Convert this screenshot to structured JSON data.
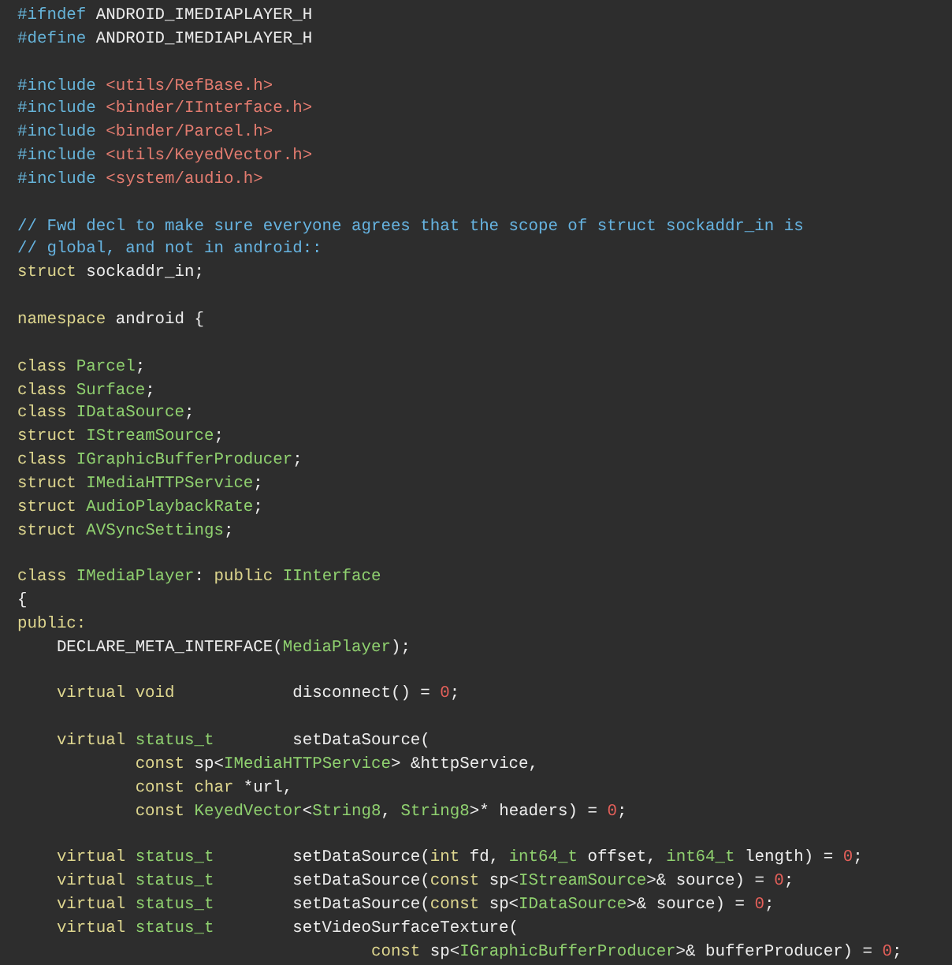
{
  "editor": {
    "lines": [
      {
        "kind": "code",
        "tokens": [
          {
            "kind": "directive",
            "text": "#ifndef"
          },
          {
            "kind": "plain",
            "text": " ANDROID_IMEDIAPLAYER_H"
          }
        ]
      },
      {
        "kind": "code",
        "tokens": [
          {
            "kind": "directive",
            "text": "#define"
          },
          {
            "kind": "plain",
            "text": " ANDROID_IMEDIAPLAYER_H"
          }
        ]
      },
      {
        "kind": "blank"
      },
      {
        "kind": "code",
        "tokens": [
          {
            "kind": "directive",
            "text": "#include"
          },
          {
            "kind": "string",
            "text": " <utils/RefBase.h>"
          }
        ]
      },
      {
        "kind": "code",
        "tokens": [
          {
            "kind": "directive",
            "text": "#include"
          },
          {
            "kind": "string",
            "text": " <binder/IInterface.h>"
          }
        ]
      },
      {
        "kind": "code",
        "tokens": [
          {
            "kind": "directive",
            "text": "#include"
          },
          {
            "kind": "string",
            "text": " <binder/Parcel.h>"
          }
        ]
      },
      {
        "kind": "code",
        "tokens": [
          {
            "kind": "directive",
            "text": "#include"
          },
          {
            "kind": "string",
            "text": " <utils/KeyedVector.h>"
          }
        ]
      },
      {
        "kind": "code",
        "tokens": [
          {
            "kind": "directive",
            "text": "#include"
          },
          {
            "kind": "string",
            "text": " <system/audio.h>"
          }
        ]
      },
      {
        "kind": "blank"
      },
      {
        "kind": "code",
        "tokens": [
          {
            "kind": "comment",
            "text": "// Fwd decl to make sure everyone agrees that the scope of struct sockaddr_in is"
          }
        ]
      },
      {
        "kind": "code",
        "tokens": [
          {
            "kind": "comment",
            "text": "// global, and not in android::"
          }
        ]
      },
      {
        "kind": "code",
        "tokens": [
          {
            "kind": "keyword",
            "text": "struct"
          },
          {
            "kind": "plain",
            "text": " sockaddr_in;"
          }
        ]
      },
      {
        "kind": "blank"
      },
      {
        "kind": "code",
        "tokens": [
          {
            "kind": "keyword",
            "text": "namespace"
          },
          {
            "kind": "plain",
            "text": " android {"
          }
        ]
      },
      {
        "kind": "blank"
      },
      {
        "kind": "code",
        "tokens": [
          {
            "kind": "keyword",
            "text": "class"
          },
          {
            "kind": "type",
            "text": " Parcel"
          },
          {
            "kind": "plain",
            "text": ";"
          }
        ]
      },
      {
        "kind": "code",
        "tokens": [
          {
            "kind": "keyword",
            "text": "class"
          },
          {
            "kind": "type",
            "text": " Surface"
          },
          {
            "kind": "plain",
            "text": ";"
          }
        ]
      },
      {
        "kind": "code",
        "tokens": [
          {
            "kind": "keyword",
            "text": "class"
          },
          {
            "kind": "type",
            "text": " IDataSource"
          },
          {
            "kind": "plain",
            "text": ";"
          }
        ]
      },
      {
        "kind": "code",
        "tokens": [
          {
            "kind": "keyword",
            "text": "struct"
          },
          {
            "kind": "type",
            "text": " IStreamSource"
          },
          {
            "kind": "plain",
            "text": ";"
          }
        ]
      },
      {
        "kind": "code",
        "tokens": [
          {
            "kind": "keyword",
            "text": "class"
          },
          {
            "kind": "type",
            "text": " IGraphicBufferProducer"
          },
          {
            "kind": "plain",
            "text": ";"
          }
        ]
      },
      {
        "kind": "code",
        "tokens": [
          {
            "kind": "keyword",
            "text": "struct"
          },
          {
            "kind": "type",
            "text": " IMediaHTTPService"
          },
          {
            "kind": "plain",
            "text": ";"
          }
        ]
      },
      {
        "kind": "code",
        "tokens": [
          {
            "kind": "keyword",
            "text": "struct"
          },
          {
            "kind": "type",
            "text": " AudioPlaybackRate"
          },
          {
            "kind": "plain",
            "text": ";"
          }
        ]
      },
      {
        "kind": "code",
        "tokens": [
          {
            "kind": "keyword",
            "text": "struct"
          },
          {
            "kind": "type",
            "text": " AVSyncSettings"
          },
          {
            "kind": "plain",
            "text": ";"
          }
        ]
      },
      {
        "kind": "blank"
      },
      {
        "kind": "code",
        "tokens": [
          {
            "kind": "keyword",
            "text": "class"
          },
          {
            "kind": "type",
            "text": " IMediaPlayer"
          },
          {
            "kind": "plain",
            "text": ": "
          },
          {
            "kind": "keyword",
            "text": "public"
          },
          {
            "kind": "type",
            "text": " IInterface"
          }
        ]
      },
      {
        "kind": "code",
        "tokens": [
          {
            "kind": "plain",
            "text": "{"
          }
        ]
      },
      {
        "kind": "code",
        "tokens": [
          {
            "kind": "keyword",
            "text": "public:"
          }
        ]
      },
      {
        "kind": "code",
        "tokens": [
          {
            "kind": "plain",
            "text": "    DECLARE_META_INTERFACE("
          },
          {
            "kind": "type",
            "text": "MediaPlayer"
          },
          {
            "kind": "plain",
            "text": ");"
          }
        ]
      },
      {
        "kind": "blank"
      },
      {
        "kind": "code",
        "tokens": [
          {
            "kind": "keyword",
            "text": "    virtual void"
          },
          {
            "kind": "plain",
            "text": "            disconnect() = "
          },
          {
            "kind": "number",
            "text": "0"
          },
          {
            "kind": "plain",
            "text": ";"
          }
        ]
      },
      {
        "kind": "blank"
      },
      {
        "kind": "code",
        "tokens": [
          {
            "kind": "keyword",
            "text": "    virtual"
          },
          {
            "kind": "type",
            "text": " status_t"
          },
          {
            "kind": "plain",
            "text": "        setDataSource("
          }
        ]
      },
      {
        "kind": "code",
        "tokens": [
          {
            "kind": "keyword",
            "text": "            const"
          },
          {
            "kind": "plain",
            "text": " sp<"
          },
          {
            "kind": "type",
            "text": "IMediaHTTPService"
          },
          {
            "kind": "plain",
            "text": "> &httpService,"
          }
        ]
      },
      {
        "kind": "code",
        "tokens": [
          {
            "kind": "keyword",
            "text": "            const char"
          },
          {
            "kind": "plain",
            "text": " *url,"
          }
        ]
      },
      {
        "kind": "code",
        "tokens": [
          {
            "kind": "keyword",
            "text": "            const"
          },
          {
            "kind": "type",
            "text": " KeyedVector"
          },
          {
            "kind": "plain",
            "text": "<"
          },
          {
            "kind": "type",
            "text": "String8"
          },
          {
            "kind": "plain",
            "text": ", "
          },
          {
            "kind": "type",
            "text": "String8"
          },
          {
            "kind": "plain",
            "text": ">* headers) = "
          },
          {
            "kind": "number",
            "text": "0"
          },
          {
            "kind": "plain",
            "text": ";"
          }
        ]
      },
      {
        "kind": "blank"
      },
      {
        "kind": "code",
        "tokens": [
          {
            "kind": "keyword",
            "text": "    virtual"
          },
          {
            "kind": "type",
            "text": " status_t"
          },
          {
            "kind": "plain",
            "text": "        setDataSource("
          },
          {
            "kind": "keyword",
            "text": "int"
          },
          {
            "kind": "plain",
            "text": " fd, "
          },
          {
            "kind": "type",
            "text": "int64_t"
          },
          {
            "kind": "plain",
            "text": " offset, "
          },
          {
            "kind": "type",
            "text": "int64_t"
          },
          {
            "kind": "plain",
            "text": " length) = "
          },
          {
            "kind": "number",
            "text": "0"
          },
          {
            "kind": "plain",
            "text": ";"
          }
        ]
      },
      {
        "kind": "code",
        "tokens": [
          {
            "kind": "keyword",
            "text": "    virtual"
          },
          {
            "kind": "type",
            "text": " status_t"
          },
          {
            "kind": "plain",
            "text": "        setDataSource("
          },
          {
            "kind": "keyword",
            "text": "const"
          },
          {
            "kind": "plain",
            "text": " sp<"
          },
          {
            "kind": "type",
            "text": "IStreamSource"
          },
          {
            "kind": "plain",
            "text": ">& source) = "
          },
          {
            "kind": "number",
            "text": "0"
          },
          {
            "kind": "plain",
            "text": ";"
          }
        ]
      },
      {
        "kind": "code",
        "tokens": [
          {
            "kind": "keyword",
            "text": "    virtual"
          },
          {
            "kind": "type",
            "text": " status_t"
          },
          {
            "kind": "plain",
            "text": "        setDataSource("
          },
          {
            "kind": "keyword",
            "text": "const"
          },
          {
            "kind": "plain",
            "text": " sp<"
          },
          {
            "kind": "type",
            "text": "IDataSource"
          },
          {
            "kind": "plain",
            "text": ">& source) = "
          },
          {
            "kind": "number",
            "text": "0"
          },
          {
            "kind": "plain",
            "text": ";"
          }
        ]
      },
      {
        "kind": "code",
        "tokens": [
          {
            "kind": "keyword",
            "text": "    virtual"
          },
          {
            "kind": "type",
            "text": " status_t"
          },
          {
            "kind": "plain",
            "text": "        setVideoSurfaceTexture("
          }
        ]
      },
      {
        "kind": "code",
        "tokens": [
          {
            "kind": "keyword",
            "text": "                                    const"
          },
          {
            "kind": "plain",
            "text": " sp<"
          },
          {
            "kind": "type",
            "text": "IGraphicBufferProducer"
          },
          {
            "kind": "plain",
            "text": ">& bufferProducer) = "
          },
          {
            "kind": "number",
            "text": "0"
          },
          {
            "kind": "plain",
            "text": ";"
          }
        ]
      }
    ]
  }
}
